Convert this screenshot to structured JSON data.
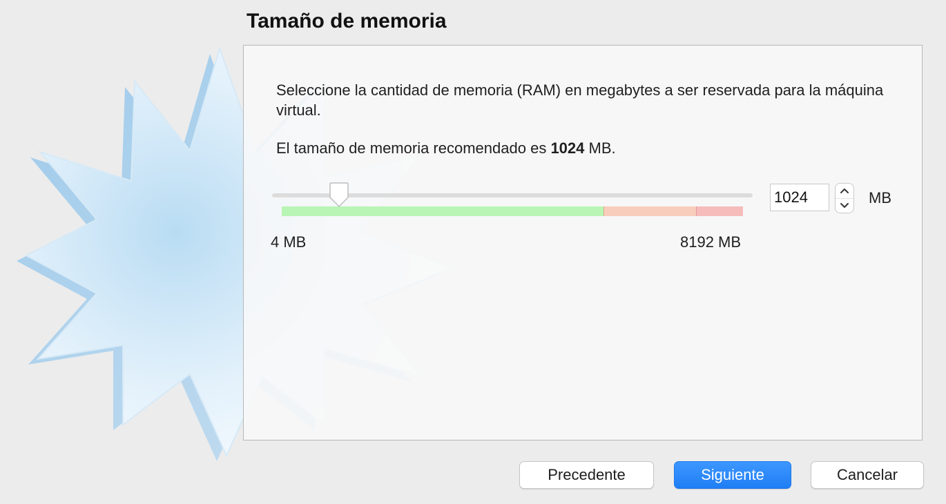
{
  "page": {
    "title": "Tamaño de memoria",
    "description": "Seleccione la cantidad de memoria (RAM) en megabytes a ser reservada para la máquina virtual.",
    "recommended_prefix": "El tamaño de memoria recomendado es ",
    "recommended_value": "1024",
    "recommended_suffix": " MB."
  },
  "memory": {
    "value": "1024",
    "unit": "MB",
    "min_label": "4 MB",
    "max_label": "8192 MB",
    "min_mb": 4,
    "max_mb": 8192,
    "current_mb": 1024,
    "safe_limit_fraction": 0.7,
    "warning_limit_fraction": 0.9
  },
  "buttons": {
    "back": "Precedente",
    "next": "Siguiente",
    "cancel": "Cancelar"
  },
  "icons": {
    "spin_up": "chevron-up-icon",
    "spin_down": "chevron-down-icon",
    "decoration": "starburst-illustration"
  },
  "colors": {
    "accent": "#1f7ef5",
    "range_safe": "#b9f5b4",
    "range_warning": "#f8cdbc",
    "range_danger": "#f6bcbc"
  }
}
